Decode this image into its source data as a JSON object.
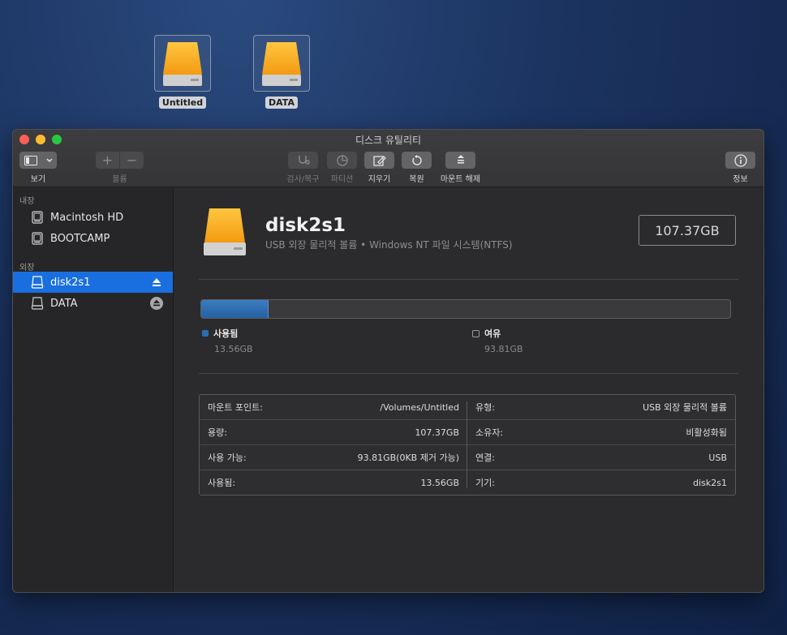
{
  "desktop": {
    "icons": [
      {
        "label": "Untitled"
      },
      {
        "label": "DATA"
      }
    ]
  },
  "window": {
    "title": "디스크 유틸리티"
  },
  "toolbar": {
    "view_label": "보기",
    "volume_label": "볼륨",
    "volume_add": "+",
    "volume_remove": "−",
    "first_aid_label": "검사/복구",
    "partition_label": "파티션",
    "erase_label": "지우기",
    "restore_label": "복원",
    "unmount_label": "마운트 해제",
    "info_label": "정보"
  },
  "sidebar": {
    "internal_header": "내장",
    "internal_items": [
      {
        "label": "Macintosh HD"
      },
      {
        "label": "BOOTCAMP"
      }
    ],
    "external_header": "외장",
    "external_items": [
      {
        "label": "disk2s1",
        "selected": true
      },
      {
        "label": "DATA",
        "selected": false
      }
    ]
  },
  "volume": {
    "name": "disk2s1",
    "description": "USB 외장 물리적 볼륨 • Windows NT 파일 시스템(NTFS)",
    "capacity": "107.37GB"
  },
  "usage": {
    "used_fraction": 0.1263,
    "used_label": "사용됨",
    "used_value": "13.56GB",
    "used_color": "#2e6db0",
    "free_label": "여유",
    "free_value": "93.81GB"
  },
  "info": {
    "left": [
      {
        "key": "마운트 포인트:",
        "value": "/Volumes/Untitled"
      },
      {
        "key": "용량:",
        "value": "107.37GB"
      },
      {
        "key": "사용 가능:",
        "value": "93.81GB(0KB 제거 가능)"
      },
      {
        "key": "사용됨:",
        "value": "13.56GB"
      }
    ],
    "right": [
      {
        "key": "유형:",
        "value": "USB 외장 물리적 볼륨"
      },
      {
        "key": "소유자:",
        "value": "비활성화됨"
      },
      {
        "key": "연결:",
        "value": "USB"
      },
      {
        "key": "기기:",
        "value": "disk2s1"
      }
    ]
  }
}
